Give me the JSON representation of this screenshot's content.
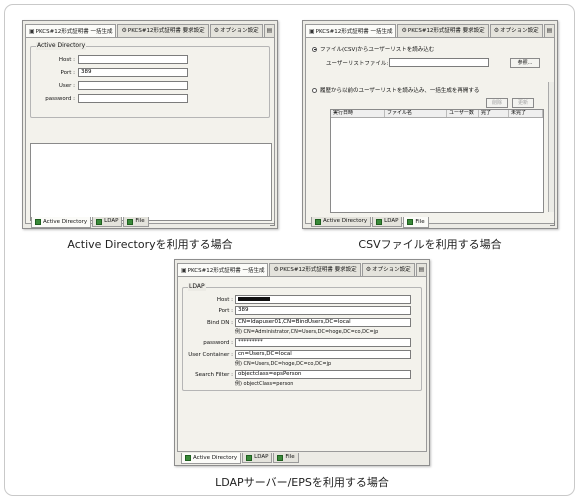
{
  "window_tabs": {
    "tab1": "PKCS#12形式証明書 一括生成",
    "tab2": "PKCS#12形式証明書 要求設定",
    "tab3": "オプション設定"
  },
  "bottom_tabs": {
    "ad": "Active Directory",
    "ldap": "LDAP",
    "file": "File"
  },
  "panel_ad": {
    "group_title": "Active Directory",
    "fields": [
      {
        "label": "Host :",
        "value": ""
      },
      {
        "label": "Port :",
        "value": "389"
      },
      {
        "label": "User :",
        "value": ""
      },
      {
        "label": "password :",
        "value": ""
      }
    ],
    "caption": "Active Directoryを利用する場合"
  },
  "panel_csv": {
    "option1": "ファイル(CSV)からユーザーリストを読み込む",
    "file_label": "ユーザーリストファイル:",
    "browse_button": "参照...",
    "option2": "履歴から以前のユーザーリストを読み込み、一括生成を再開する",
    "delete_button": "削除",
    "refresh_button": "更新",
    "columns": [
      "実行日時",
      "ファイル名",
      "ユーザー数",
      "完了",
      "未完了"
    ],
    "caption": "CSVファイルを利用する場合"
  },
  "panel_ldap": {
    "group_title": "LDAP",
    "host_label": "Host :",
    "host_value": "",
    "port_label": "Port :",
    "port_value": "389",
    "binddn_label": "Bind DN :",
    "binddn_value": "CN=ldapuser01,CN=BindUsers,DC=local",
    "binddn_example": "例) CN=Administrator,CN=Users,DC=hoge,DC=co,DC=jp",
    "password_label": "password :",
    "password_value": "*********",
    "container_label": "User Container :",
    "container_value": "cn=Users,DC=local",
    "container_example": "例) CN=Users,DC=hoge,DC=co,DC=jp",
    "filter_label": "Search Filter :",
    "filter_value": "objectclass=epsPerson",
    "filter_example": "例) objectClass=person",
    "caption": "LDAPサーバー/EPSを利用する場合"
  },
  "colors": {
    "window_bg": "#ecebe5",
    "border": "#8d8d8d",
    "tab_icon": "#3a8a3a"
  }
}
